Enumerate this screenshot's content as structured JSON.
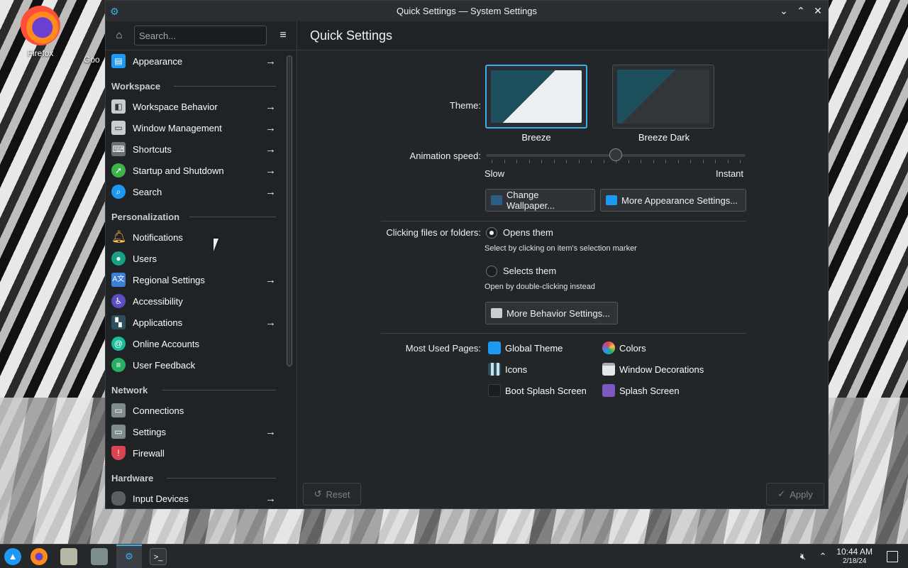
{
  "desktop": {
    "icons": [
      {
        "label": "Firefox"
      },
      {
        "label": "Goo"
      }
    ]
  },
  "window": {
    "title": "Quick Settings — System Settings",
    "controls": {
      "minimize": "⌄",
      "maximize": "⌃",
      "close": "✕"
    }
  },
  "sidebar": {
    "search_placeholder": "Search...",
    "top_item": {
      "label": "Appearance",
      "icon": "appearance-icon",
      "color": "#1d99f3"
    },
    "sections": [
      {
        "title": "Workspace",
        "items": [
          {
            "label": "Workspace Behavior",
            "icon": "workspace-behavior-icon",
            "arrow": true,
            "color": "#c8cdd2"
          },
          {
            "label": "Window Management",
            "icon": "window-management-icon",
            "arrow": true,
            "color": "#c8cdd2"
          },
          {
            "label": "Shortcuts",
            "icon": "keyboard-icon",
            "arrow": true,
            "color": "#6d6f72"
          },
          {
            "label": "Startup and Shutdown",
            "icon": "rocket-icon",
            "arrow": true,
            "color": "#3bb54a"
          },
          {
            "label": "Search",
            "icon": "search-icon",
            "arrow": true,
            "color": "#1d99f3"
          }
        ]
      },
      {
        "title": "Personalization",
        "items": [
          {
            "label": "Notifications",
            "icon": "bell-icon",
            "arrow": false,
            "color": "#fdbc4b"
          },
          {
            "label": "Users",
            "icon": "user-icon",
            "arrow": false,
            "color": "#16a085"
          },
          {
            "label": "Regional Settings",
            "icon": "language-icon",
            "arrow": true,
            "color": "#3d7ed9"
          },
          {
            "label": "Accessibility",
            "icon": "accessibility-icon",
            "arrow": false,
            "color": "#5d4fc1"
          },
          {
            "label": "Applications",
            "icon": "applications-icon",
            "arrow": true,
            "color": "#2f4f5f"
          },
          {
            "label": "Online Accounts",
            "icon": "at-icon",
            "arrow": false,
            "color": "#1abc9c"
          },
          {
            "label": "User Feedback",
            "icon": "feedback-icon",
            "arrow": false,
            "color": "#27ae60"
          }
        ]
      },
      {
        "title": "Network",
        "items": [
          {
            "label": "Connections",
            "icon": "network-icon",
            "arrow": false,
            "color": "#7f8c8d"
          },
          {
            "label": "Settings",
            "icon": "network-settings-icon",
            "arrow": true,
            "color": "#7f8c8d"
          },
          {
            "label": "Firewall",
            "icon": "shield-icon",
            "arrow": false,
            "color": "#da4453"
          }
        ]
      },
      {
        "title": "Hardware",
        "items": [
          {
            "label": "Input Devices",
            "icon": "mouse-icon",
            "arrow": true,
            "color": "#5c5f62"
          }
        ]
      }
    ]
  },
  "main": {
    "title": "Quick Settings",
    "theme": {
      "label": "Theme:",
      "options": [
        {
          "name": "Breeze",
          "selected": true
        },
        {
          "name": "Breeze Dark",
          "selected": false
        }
      ]
    },
    "animation": {
      "label": "Animation speed:",
      "min_label": "Slow",
      "max_label": "Instant",
      "value": 0.5
    },
    "buttons": {
      "change_wallpaper": "Change Wallpaper...",
      "more_appearance": "More Appearance Settings...",
      "more_behavior": "More Behavior Settings..."
    },
    "clicking": {
      "label": "Clicking files or folders:",
      "options": [
        {
          "label": "Opens them",
          "hint": "Select by clicking on item's selection marker",
          "selected": true
        },
        {
          "label": "Selects them",
          "hint": "Open by double-clicking instead",
          "selected": false
        }
      ]
    },
    "most_used": {
      "label": "Most Used Pages:",
      "items": [
        {
          "label": "Global Theme",
          "icon": "global-theme-icon"
        },
        {
          "label": "Colors",
          "icon": "colors-icon"
        },
        {
          "label": "Icons",
          "icon": "icons-icon"
        },
        {
          "label": "Window Decorations",
          "icon": "window-decorations-icon"
        },
        {
          "label": "Boot Splash Screen",
          "icon": "boot-splash-icon"
        },
        {
          "label": "Splash Screen",
          "icon": "splash-screen-icon"
        }
      ]
    },
    "footer": {
      "reset": "Reset",
      "apply": "Apply"
    }
  },
  "taskbar": {
    "time": "10:44 AM",
    "date": "2/18/24"
  }
}
